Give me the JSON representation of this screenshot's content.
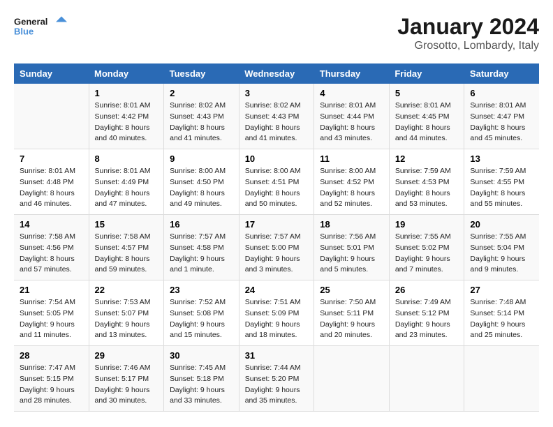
{
  "logo": {
    "line1": "General",
    "line2": "Blue"
  },
  "title": "January 2024",
  "location": "Grosotto, Lombardy, Italy",
  "days_of_week": [
    "Sunday",
    "Monday",
    "Tuesday",
    "Wednesday",
    "Thursday",
    "Friday",
    "Saturday"
  ],
  "weeks": [
    [
      {
        "day": "",
        "info": ""
      },
      {
        "day": "1",
        "info": "Sunrise: 8:01 AM\nSunset: 4:42 PM\nDaylight: 8 hours\nand 40 minutes."
      },
      {
        "day": "2",
        "info": "Sunrise: 8:02 AM\nSunset: 4:43 PM\nDaylight: 8 hours\nand 41 minutes."
      },
      {
        "day": "3",
        "info": "Sunrise: 8:02 AM\nSunset: 4:43 PM\nDaylight: 8 hours\nand 41 minutes."
      },
      {
        "day": "4",
        "info": "Sunrise: 8:01 AM\nSunset: 4:44 PM\nDaylight: 8 hours\nand 43 minutes."
      },
      {
        "day": "5",
        "info": "Sunrise: 8:01 AM\nSunset: 4:45 PM\nDaylight: 8 hours\nand 44 minutes."
      },
      {
        "day": "6",
        "info": "Sunrise: 8:01 AM\nSunset: 4:47 PM\nDaylight: 8 hours\nand 45 minutes."
      }
    ],
    [
      {
        "day": "7",
        "info": "Sunrise: 8:01 AM\nSunset: 4:48 PM\nDaylight: 8 hours\nand 46 minutes."
      },
      {
        "day": "8",
        "info": "Sunrise: 8:01 AM\nSunset: 4:49 PM\nDaylight: 8 hours\nand 47 minutes."
      },
      {
        "day": "9",
        "info": "Sunrise: 8:00 AM\nSunset: 4:50 PM\nDaylight: 8 hours\nand 49 minutes."
      },
      {
        "day": "10",
        "info": "Sunrise: 8:00 AM\nSunset: 4:51 PM\nDaylight: 8 hours\nand 50 minutes."
      },
      {
        "day": "11",
        "info": "Sunrise: 8:00 AM\nSunset: 4:52 PM\nDaylight: 8 hours\nand 52 minutes."
      },
      {
        "day": "12",
        "info": "Sunrise: 7:59 AM\nSunset: 4:53 PM\nDaylight: 8 hours\nand 53 minutes."
      },
      {
        "day": "13",
        "info": "Sunrise: 7:59 AM\nSunset: 4:55 PM\nDaylight: 8 hours\nand 55 minutes."
      }
    ],
    [
      {
        "day": "14",
        "info": "Sunrise: 7:58 AM\nSunset: 4:56 PM\nDaylight: 8 hours\nand 57 minutes."
      },
      {
        "day": "15",
        "info": "Sunrise: 7:58 AM\nSunset: 4:57 PM\nDaylight: 8 hours\nand 59 minutes."
      },
      {
        "day": "16",
        "info": "Sunrise: 7:57 AM\nSunset: 4:58 PM\nDaylight: 9 hours\nand 1 minute."
      },
      {
        "day": "17",
        "info": "Sunrise: 7:57 AM\nSunset: 5:00 PM\nDaylight: 9 hours\nand 3 minutes."
      },
      {
        "day": "18",
        "info": "Sunrise: 7:56 AM\nSunset: 5:01 PM\nDaylight: 9 hours\nand 5 minutes."
      },
      {
        "day": "19",
        "info": "Sunrise: 7:55 AM\nSunset: 5:02 PM\nDaylight: 9 hours\nand 7 minutes."
      },
      {
        "day": "20",
        "info": "Sunrise: 7:55 AM\nSunset: 5:04 PM\nDaylight: 9 hours\nand 9 minutes."
      }
    ],
    [
      {
        "day": "21",
        "info": "Sunrise: 7:54 AM\nSunset: 5:05 PM\nDaylight: 9 hours\nand 11 minutes."
      },
      {
        "day": "22",
        "info": "Sunrise: 7:53 AM\nSunset: 5:07 PM\nDaylight: 9 hours\nand 13 minutes."
      },
      {
        "day": "23",
        "info": "Sunrise: 7:52 AM\nSunset: 5:08 PM\nDaylight: 9 hours\nand 15 minutes."
      },
      {
        "day": "24",
        "info": "Sunrise: 7:51 AM\nSunset: 5:09 PM\nDaylight: 9 hours\nand 18 minutes."
      },
      {
        "day": "25",
        "info": "Sunrise: 7:50 AM\nSunset: 5:11 PM\nDaylight: 9 hours\nand 20 minutes."
      },
      {
        "day": "26",
        "info": "Sunrise: 7:49 AM\nSunset: 5:12 PM\nDaylight: 9 hours\nand 23 minutes."
      },
      {
        "day": "27",
        "info": "Sunrise: 7:48 AM\nSunset: 5:14 PM\nDaylight: 9 hours\nand 25 minutes."
      }
    ],
    [
      {
        "day": "28",
        "info": "Sunrise: 7:47 AM\nSunset: 5:15 PM\nDaylight: 9 hours\nand 28 minutes."
      },
      {
        "day": "29",
        "info": "Sunrise: 7:46 AM\nSunset: 5:17 PM\nDaylight: 9 hours\nand 30 minutes."
      },
      {
        "day": "30",
        "info": "Sunrise: 7:45 AM\nSunset: 5:18 PM\nDaylight: 9 hours\nand 33 minutes."
      },
      {
        "day": "31",
        "info": "Sunrise: 7:44 AM\nSunset: 5:20 PM\nDaylight: 9 hours\nand 35 minutes."
      },
      {
        "day": "",
        "info": ""
      },
      {
        "day": "",
        "info": ""
      },
      {
        "day": "",
        "info": ""
      }
    ]
  ]
}
